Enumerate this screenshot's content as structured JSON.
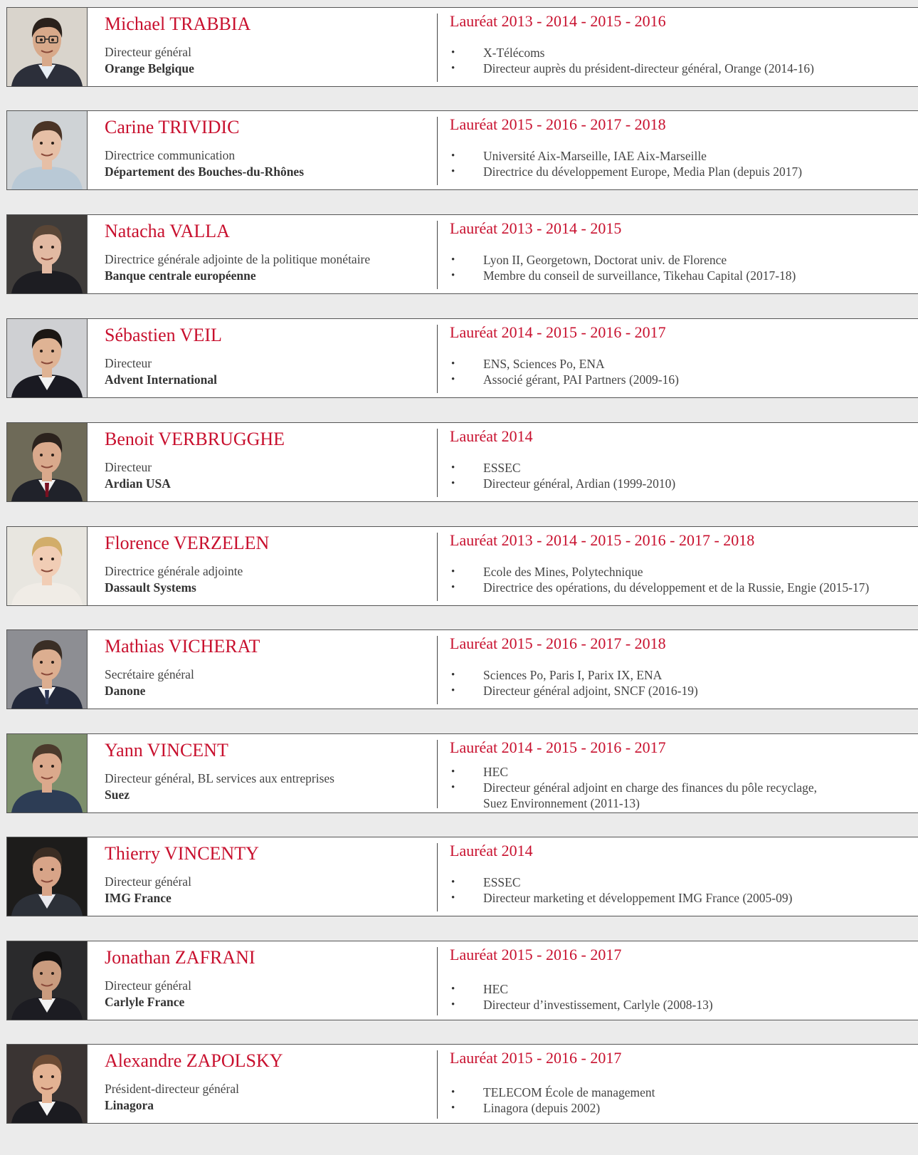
{
  "profiles": [
    {
      "name": "Michael TRABBIA",
      "role": "Directeur général",
      "org": "Orange Belgique",
      "laureat": "Lauréat 2013 - 2014 - 2015 - 2016",
      "bullets": [
        "X-Télécoms",
        "Directeur auprès du président-directeur général, Orange (2014-16)"
      ]
    },
    {
      "name": "Carine TRIVIDIC",
      "role": "Directrice communication",
      "org": "Département des Bouches-du-Rhônes",
      "laureat": "Lauréat 2015 - 2016 - 2017 - 2018",
      "bullets": [
        "Université Aix-Marseille, IAE Aix-Marseille",
        "Directrice du développement Europe, Media Plan (depuis 2017)"
      ]
    },
    {
      "name": "Natacha VALLA",
      "role": "Directrice générale adjointe de la politique monétaire",
      "org": "Banque centrale européenne",
      "laureat": "Lauréat 2013 - 2014 - 2015",
      "bullets": [
        "Lyon II, Georgetown, Doctorat univ. de Florence",
        "Membre du conseil de surveillance, Tikehau Capital (2017-18)"
      ]
    },
    {
      "name": "Sébastien VEIL",
      "role": "Directeur",
      "org": "Advent International",
      "laureat": "Lauréat 2014 - 2015 - 2016 - 2017",
      "bullets": [
        "ENS, Sciences Po, ENA",
        "Associé gérant, PAI Partners (2009-16)"
      ]
    },
    {
      "name": "Benoit VERBRUGGHE",
      "role": "Directeur",
      "org": "Ardian USA",
      "laureat": "Lauréat 2014",
      "bullets": [
        "ESSEC",
        "Directeur général, Ardian (1999-2010)"
      ]
    },
    {
      "name": "Florence VERZELEN",
      "role": "Directrice générale adjointe",
      "org": "Dassault Systems",
      "laureat": "Lauréat 2013 - 2014 - 2015 - 2016 - 2017 - 2018",
      "bullets": [
        "Ecole des Mines, Polytechnique",
        "Directrice des opérations, du développement et de la Russie, Engie (2015-17)"
      ]
    },
    {
      "name": "Mathias VICHERAT",
      "role": "Secrétaire général",
      "org": "Danone",
      "laureat": "Lauréat 2015 - 2016 - 2017 - 2018",
      "bullets": [
        "Sciences Po, Paris I, Parix IX, ENA",
        "Directeur général adjoint, SNCF (2016-19)"
      ]
    },
    {
      "name": "Yann VINCENT",
      "role": "Directeur général, BL services aux entreprises",
      "org": "Suez",
      "laureat": "Lauréat 2014 - 2015 - 2016 - 2017",
      "bullets": [
        "HEC",
        "Directeur général adjoint en charge des finances du pôle recyclage,"
      ],
      "continuation": "Suez Environnement (2011-13)"
    },
    {
      "name": "Thierry VINCENTY",
      "role": "Directeur général",
      "org": "IMG France",
      "laureat": "Lauréat 2014",
      "bullets": [
        "ESSEC",
        "Directeur marketing et développement IMG France (2005-09)"
      ]
    },
    {
      "name": "Jonathan ZAFRANI",
      "role": "Directeur général",
      "org": "Carlyle France",
      "laureat": "Lauréat 2015 - 2016 - 2017",
      "bullets": [
        "HEC",
        "Directeur d’investissement, Carlyle (2008-13)"
      ]
    },
    {
      "name": "Alexandre ZAPOLSKY",
      "role": "Président-directeur général",
      "org": "Linagora",
      "laureat": "Lauréat 2015 - 2016 - 2017",
      "bullets": [
        "TELECOM École de management",
        "Linagora (depuis 2002)"
      ]
    }
  ]
}
